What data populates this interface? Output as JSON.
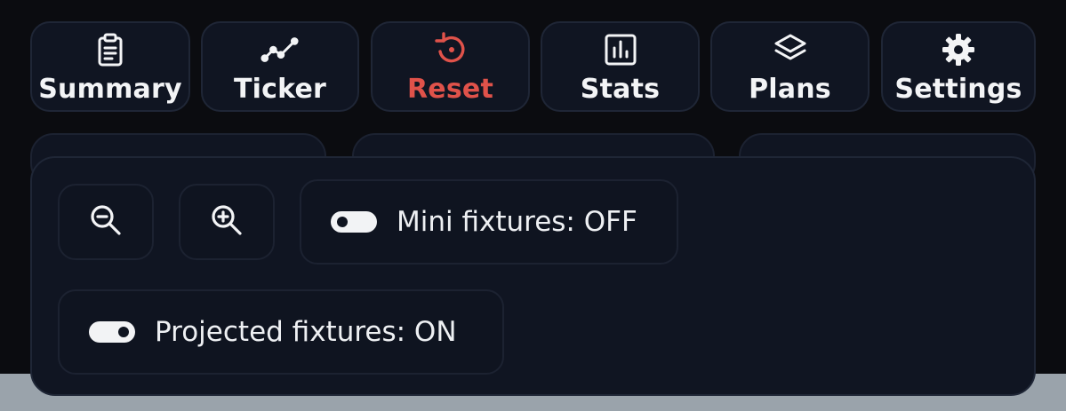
{
  "nav": {
    "buttons": [
      {
        "label": "Summary",
        "icon": "clipboard-icon"
      },
      {
        "label": "Ticker",
        "icon": "trend-line-icon"
      },
      {
        "label": "Reset",
        "icon": "reset-icon"
      },
      {
        "label": "Stats",
        "icon": "bar-chart-icon"
      },
      {
        "label": "Plans",
        "icon": "layers-icon"
      },
      {
        "label": "Settings",
        "icon": "gear-icon"
      }
    ]
  },
  "panel": {
    "zoom_out_icon": "zoom-out-icon",
    "zoom_in_icon": "zoom-in-icon",
    "mini_fixtures": {
      "label": "Mini fixtures: OFF",
      "state": "off"
    },
    "projected_fixtures": {
      "label": "Projected fixtures: ON",
      "state": "on"
    }
  },
  "colors": {
    "background": "#0b0c10",
    "surface": "#101522",
    "border": "#1f2636",
    "text": "#f3f4f6",
    "reset_accent": "#e0524a"
  }
}
